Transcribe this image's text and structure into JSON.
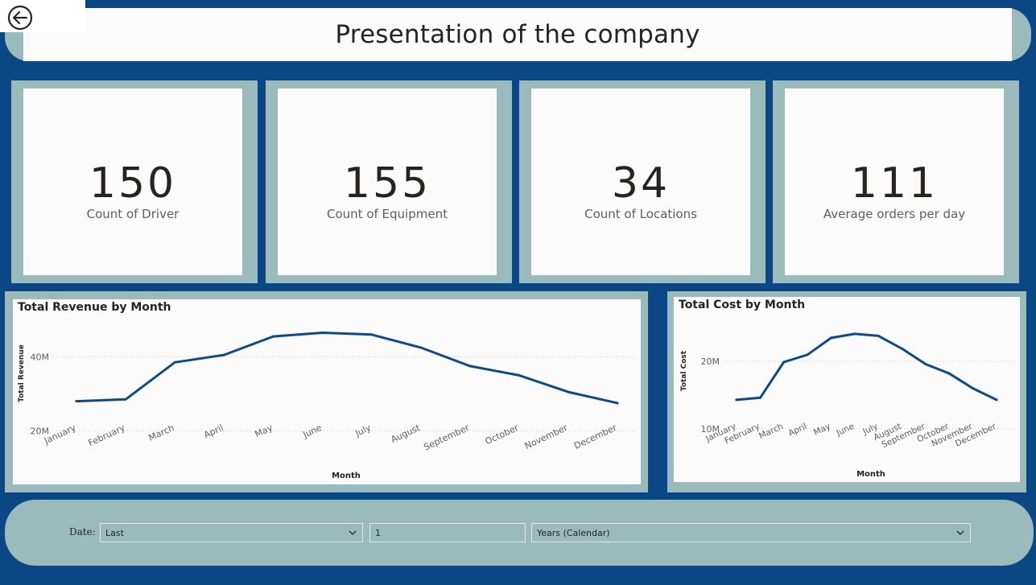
{
  "header": {
    "title": "Presentation of the company"
  },
  "back_button": {
    "icon": "back-arrow-icon"
  },
  "kpis": [
    {
      "value": "150",
      "label": "Count of Driver"
    },
    {
      "value": "155",
      "label": "Count of Equipment"
    },
    {
      "value": "34",
      "label": "Count of Locations"
    },
    {
      "value": "111",
      "label": "Average orders per day"
    }
  ],
  "colors": {
    "background": "#0b4784",
    "frame": "#9ababb",
    "card": "#fafbfa",
    "line": "#0f4a85"
  },
  "revenue_chart": {
    "title": "Total Revenue by Month"
  },
  "cost_chart": {
    "title": "Total Cost by Month"
  },
  "chart_data": [
    {
      "type": "line",
      "title": "Total Revenue by Month",
      "xlabel": "Month",
      "ylabel": "Total Revenue",
      "categories": [
        "January",
        "February",
        "March",
        "April",
        "May",
        "June",
        "July",
        "August",
        "September",
        "October",
        "November",
        "December"
      ],
      "values": [
        28.0,
        28.5,
        38.5,
        40.5,
        45.5,
        46.5,
        46.0,
        42.5,
        37.5,
        35.0,
        30.5,
        27.5
      ],
      "y_unit": "M",
      "y_ticks": [
        "20M",
        "40M"
      ],
      "ylim": [
        19,
        49
      ],
      "grid": true
    },
    {
      "type": "line",
      "title": "Total Cost by Month",
      "xlabel": "Month",
      "ylabel": "Total Cost",
      "categories": [
        "January",
        "February",
        "March",
        "April",
        "May",
        "June",
        "July",
        "August",
        "September",
        "October",
        "November",
        "December"
      ],
      "values": [
        14.3,
        14.6,
        19.9,
        21.0,
        23.5,
        24.1,
        23.8,
        21.9,
        19.6,
        18.2,
        16.0,
        14.3
      ],
      "y_unit": "M",
      "y_ticks": [
        "10M",
        "20M"
      ],
      "ylim": [
        9.5,
        26
      ],
      "grid": true
    }
  ],
  "slicer": {
    "label": "Date:",
    "period_select": "Last",
    "count_value": "1",
    "unit_select": "Years (Calendar)"
  }
}
